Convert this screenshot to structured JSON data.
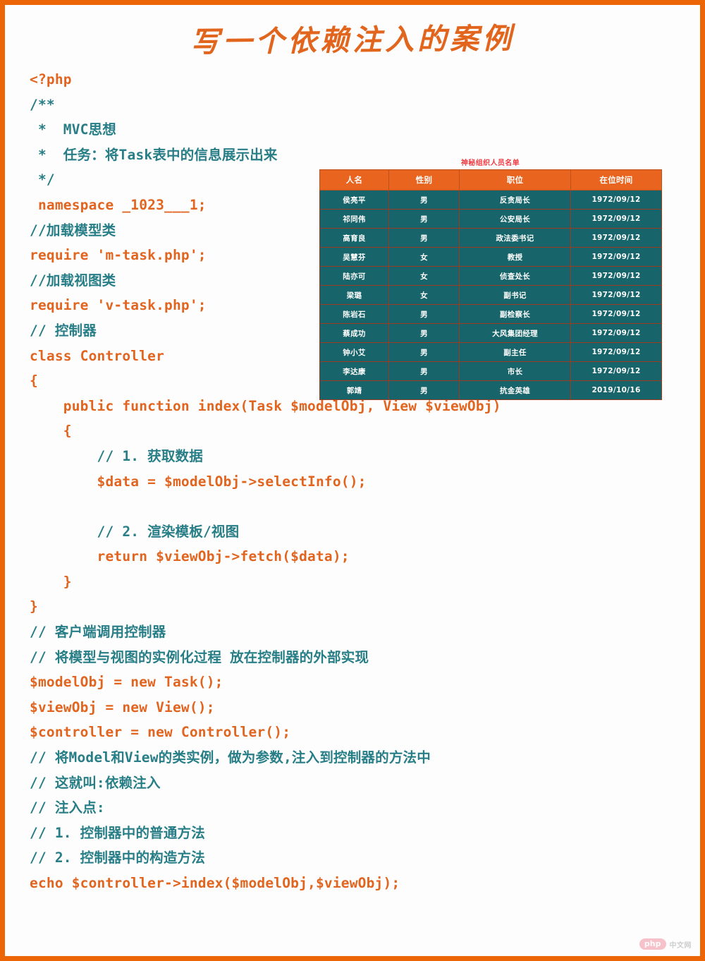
{
  "document": {
    "title": "写一个依赖注入的案例",
    "title_color": "#e2651e",
    "border_color": "#ec6608",
    "background": "#fdfdfd"
  },
  "code": {
    "comment_color": "#287e86",
    "code_color": "#e1641f",
    "lines": [
      {
        "text": "<?php",
        "type": "code"
      },
      {
        "text": "/**",
        "type": "comment"
      },
      {
        "text": " *  MVC思想",
        "type": "comment"
      },
      {
        "text": " *  任务：将Task表中的信息展示出来",
        "type": "comment"
      },
      {
        "text": " */",
        "type": "comment"
      },
      {
        "text": " namespace _1023___1;",
        "type": "code"
      },
      {
        "text": "//加载模型类",
        "type": "comment"
      },
      {
        "text": "require 'm-task.php';",
        "type": "code"
      },
      {
        "text": "//加载视图类",
        "type": "comment"
      },
      {
        "text": "require 'v-task.php';",
        "type": "code"
      },
      {
        "text": "// 控制器",
        "type": "comment"
      },
      {
        "text": "class Controller",
        "type": "code"
      },
      {
        "text": "{",
        "type": "code"
      },
      {
        "text": "    public function index(Task $modelObj, View $viewObj)",
        "type": "code"
      },
      {
        "text": "    {",
        "type": "code"
      },
      {
        "text": "        // 1. 获取数据",
        "type": "comment"
      },
      {
        "text": "        $data = $modelObj->selectInfo();",
        "type": "code"
      },
      {
        "text": "",
        "type": "code"
      },
      {
        "text": "        // 2. 渲染模板/视图",
        "type": "comment"
      },
      {
        "text": "        return $viewObj->fetch($data);",
        "type": "code"
      },
      {
        "text": "    }",
        "type": "code"
      },
      {
        "text": "}",
        "type": "code"
      },
      {
        "text": "// 客户端调用控制器",
        "type": "comment"
      },
      {
        "text": "// 将模型与视图的实例化过程 放在控制器的外部实现",
        "type": "comment"
      },
      {
        "text": "$modelObj = new Task();",
        "type": "code"
      },
      {
        "text": "$viewObj = new View();",
        "type": "code"
      },
      {
        "text": "$controller = new Controller();",
        "type": "code"
      },
      {
        "text": "// 将Model和View的类实例，做为参数,注入到控制器的方法中",
        "type": "comment"
      },
      {
        "text": "// 这就叫:依赖注入",
        "type": "comment"
      },
      {
        "text": "// 注入点:",
        "type": "comment"
      },
      {
        "text": "// 1. 控制器中的普通方法",
        "type": "comment"
      },
      {
        "text": "// 2. 控制器中的构造方法",
        "type": "comment"
      },
      {
        "text": "echo $controller->index($modelObj,$viewObj);",
        "type": "code"
      }
    ]
  },
  "table": {
    "caption": "神秘组织人员名单",
    "caption_color": "#f2393f",
    "header_bg": "#e8641f",
    "body_bg": "#17646b",
    "border_color": "#9c3a22",
    "headers": [
      "人名",
      "性别",
      "职位",
      "在位时间"
    ],
    "rows": [
      [
        "侯亮平",
        "男",
        "反贪局长",
        "1972/09/12"
      ],
      [
        "祁同伟",
        "男",
        "公安局长",
        "1972/09/12"
      ],
      [
        "高育良",
        "男",
        "政法委书记",
        "1972/09/12"
      ],
      [
        "吴慧芬",
        "女",
        "教授",
        "1972/09/12"
      ],
      [
        "陆亦可",
        "女",
        "侦查处长",
        "1972/09/12"
      ],
      [
        "梁璐",
        "女",
        "副书记",
        "1972/09/12"
      ],
      [
        "陈岩石",
        "男",
        "副检察长",
        "1972/09/12"
      ],
      [
        "蔡成功",
        "男",
        "大风集团经理",
        "1972/09/12"
      ],
      [
        "钟小艾",
        "男",
        "副主任",
        "1972/09/12"
      ],
      [
        "李达康",
        "男",
        "市长",
        "1972/09/12"
      ],
      [
        "郭靖",
        "男",
        "抗金英雄",
        "2019/10/16"
      ]
    ]
  },
  "watermark": {
    "brand": "php",
    "suffix": "中文网"
  }
}
